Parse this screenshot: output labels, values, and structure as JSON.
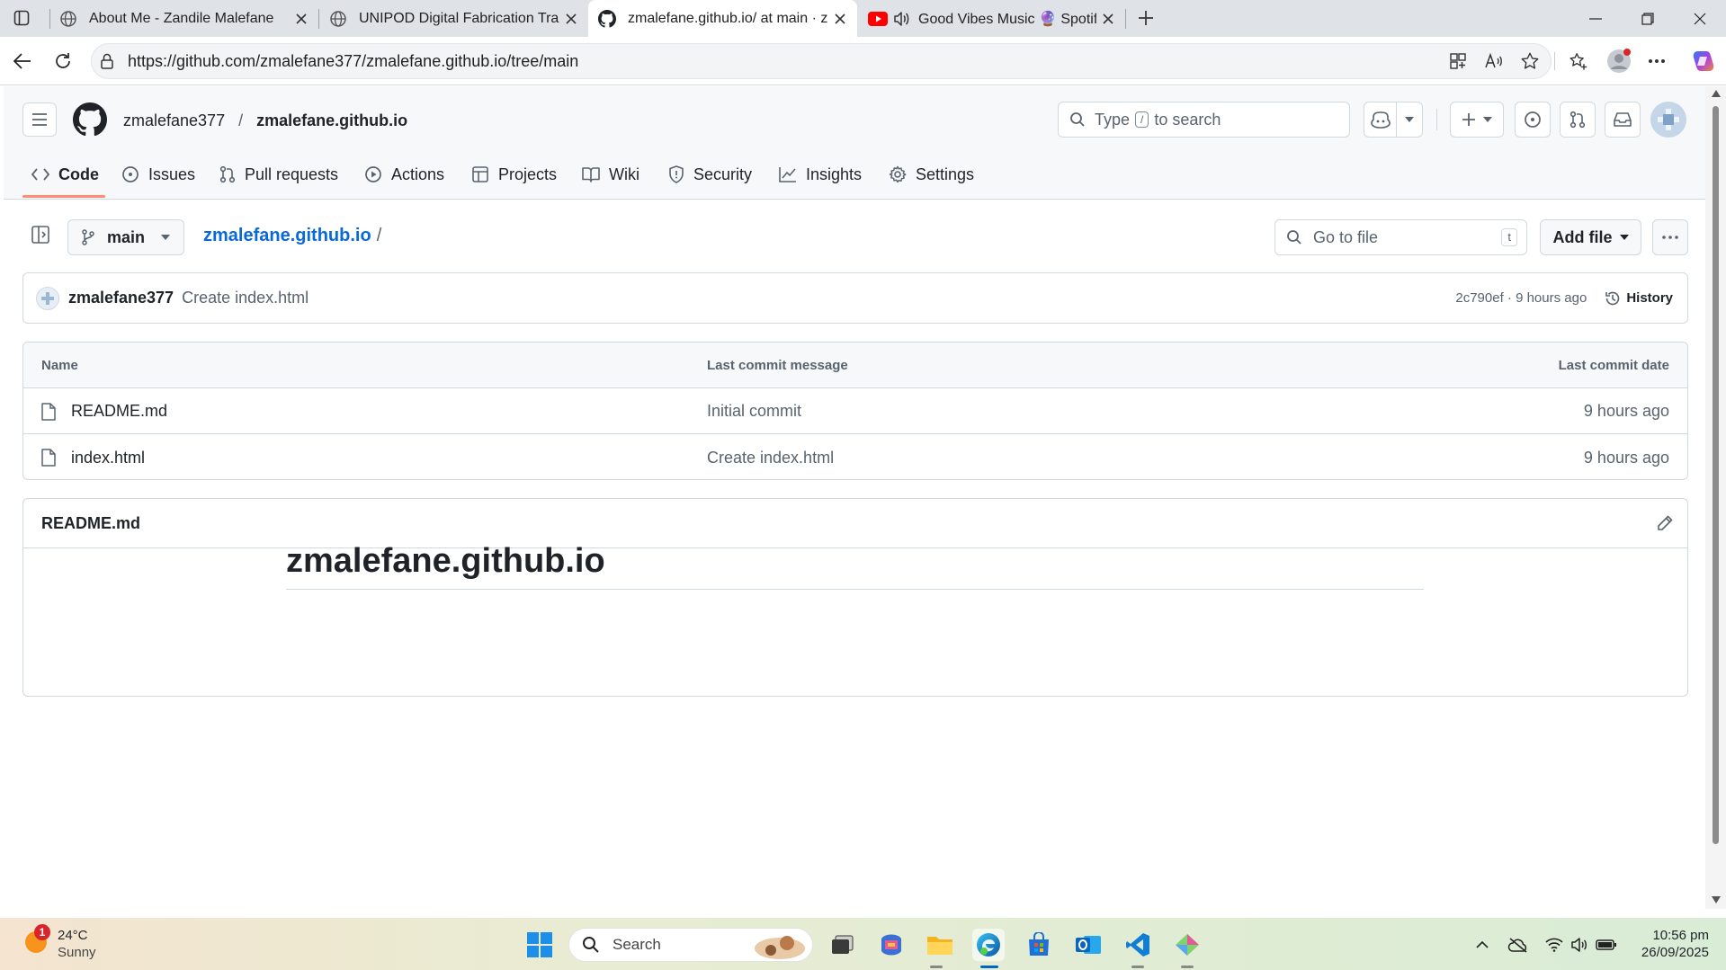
{
  "browser": {
    "tabs": [
      {
        "title": "About Me - Zandile Malefane",
        "icon": "globe-icon"
      },
      {
        "title": "UNIPOD Digital Fabrication Traini",
        "icon": "globe-icon"
      },
      {
        "title": "zmalefane.github.io/ at main · zm",
        "icon": "github-icon"
      },
      {
        "title": "Good Vibes Music 🔮 Spotif",
        "icon": "youtube-icon"
      }
    ],
    "url": "https://github.com/zmalefane377/zmalefane.github.io/tree/main"
  },
  "github": {
    "owner": "zmalefane377",
    "repo": "zmalefane.github.io",
    "search_placeholder_pre": "Type",
    "search_key": "/",
    "search_placeholder_post": "to search",
    "nav_tabs": [
      "Code",
      "Issues",
      "Pull requests",
      "Actions",
      "Projects",
      "Wiki",
      "Security",
      "Insights",
      "Settings"
    ],
    "branch": "main",
    "breadcrumb_repo": "zmalefane.github.io",
    "breadcrumb_sep": "/",
    "go_to_file": "Go to file",
    "go_to_file_key": "t",
    "add_file": "Add file",
    "commit": {
      "author": "zmalefane377",
      "message": "Create index.html",
      "hash_time": "2c790ef · 9 hours ago",
      "history": "History"
    },
    "table": {
      "headers": [
        "Name",
        "Last commit message",
        "Last commit date"
      ],
      "rows": [
        {
          "name": "README.md",
          "message": "Initial commit",
          "date": "9 hours ago"
        },
        {
          "name": "index.html",
          "message": "Create index.html",
          "date": "9 hours ago"
        }
      ]
    },
    "readme": {
      "filename": "README.md",
      "heading": "zmalefane.github.io"
    }
  },
  "taskbar": {
    "weather_temp": "24°C",
    "weather_desc": "Sunny",
    "weather_badge": "1",
    "search": "Search",
    "time": "10:56 pm",
    "date": "26/09/2025"
  },
  "colors": {
    "link": "#0969da",
    "tab_underline": "#fd8c73",
    "chrome_bg": "#dfe3e8"
  }
}
